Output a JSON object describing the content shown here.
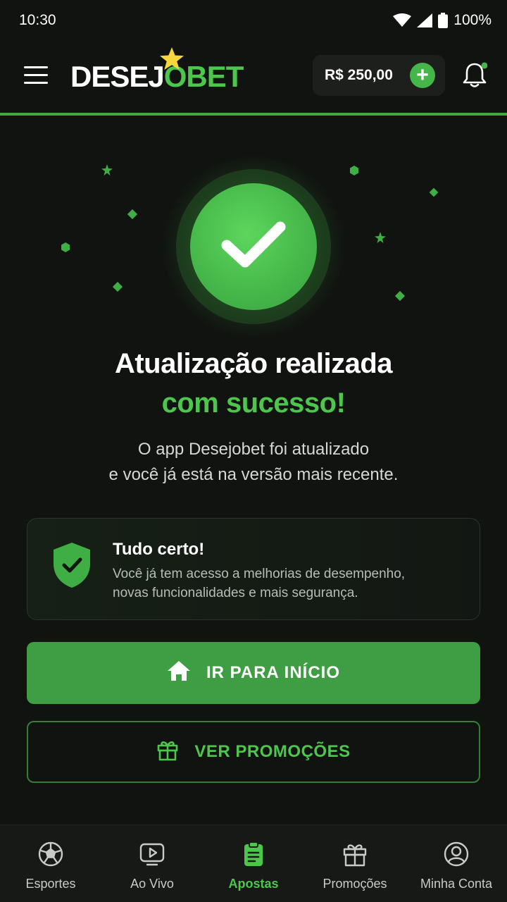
{
  "status_bar": {
    "time": "10:30",
    "battery": "100%"
  },
  "header": {
    "logo_part1": "DESEJ",
    "logo_part2": "OBET",
    "balance": "R$ 250,00",
    "add_symbol": "+"
  },
  "hero": {
    "title_line1": "Atualização realizada",
    "title_line2": "com sucesso!",
    "description_line1": "O app Desejobet foi atualizado",
    "description_line2": "e você já está na versão mais recente."
  },
  "info_card": {
    "title": "Tudo certo!",
    "text_line1": "Você já tem acesso a melhorias de desempenho,",
    "text_line2": "novas funcionalidades e mais segurança."
  },
  "actions": {
    "primary_label": "IR PARA INÍCIO",
    "secondary_label": "VER PROMOÇÕES"
  },
  "bottom_nav": {
    "items": [
      {
        "label": "Esportes",
        "icon": "soccer-ball-icon"
      },
      {
        "label": "Ao Vivo",
        "icon": "play-icon"
      },
      {
        "label": "Apostas",
        "icon": "clipboard-icon",
        "active": true
      },
      {
        "label": "Promoções",
        "icon": "gift-icon"
      },
      {
        "label": "Minha Conta",
        "icon": "user-icon"
      }
    ]
  },
  "colors": {
    "background": "#111311",
    "accent": "#4cc74c",
    "primary_button": "#3f9e43"
  }
}
